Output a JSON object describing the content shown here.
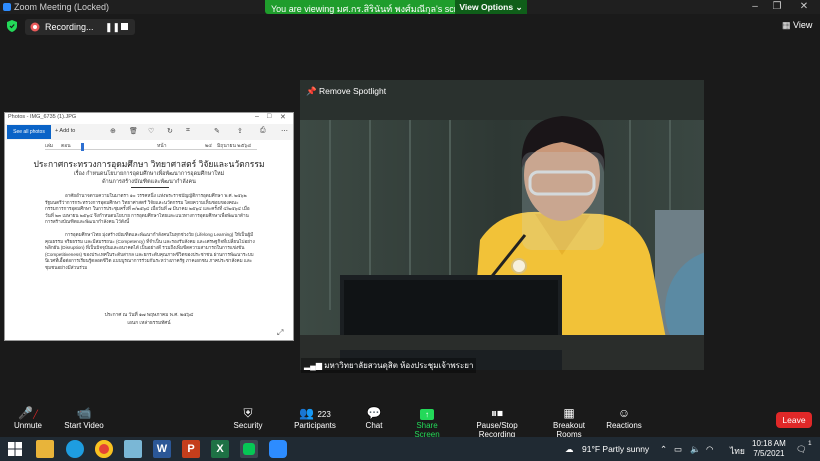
{
  "window": {
    "title": "Zoom Meeting (Locked)"
  },
  "banner": {
    "text": "You are viewing มศ.กร.สิรินันท์ พงศ์มณีกุล's screen",
    "options": "View Options ⌄"
  },
  "recording": {
    "label": "Recording..."
  },
  "topbar": {
    "view_label": "View"
  },
  "shared": {
    "window_title": "Photos - IMG_6735 (1).JPG",
    "see_all": "See all photos",
    "add_to": "+ Add to",
    "doc_title": "ประกาศกระทรวงการอุดมศึกษา วิทยาศาสตร์ วิจัยและนวัตกรรม",
    "doc_subject": "เรื่อง กำหนดนโยบายการอุดมศึกษาเพื่อพัฒนาการอุดมศึกษาใหม่",
    "doc_subject2": "ด้านการสร้างบัณฑิตและพัฒนากำลังคน",
    "para1": "อาศัยอำนาจตามความในมาตรา ๑๐ วรรคหนึ่ง แห่งพระราชบัญญัติการอุดมศึกษา พ.ศ. ๒๕๖๒ รัฐมนตรีว่าการกระทรวงการอุดมศึกษา วิทยาศาสตร์ วิจัยและนวัตกรรม โดยความเห็นชอบของคณะกรรมการการอุดมศึกษา ในการประชุมครั้งที่ ๓/๒๕๖๔ เมื่อวันที่ ๗ มีนาคม ๒๕๖๔ และครั้งที่ ๔/๒๕๖๔ เมื่อวันที่ ๒๓ เมษายน ๒๕๖๔ จึงกำหนดนโยบาย การอุดมศึกษาไทยและแนวทางการอุดมศึกษาเพื่อพัฒนาด้านการสร้างบัณฑิตและพัฒนากำลังคน ไว้ดังนี้",
    "para2": "การอุดมศึกษาไทย มุ่งสร้างบัณฑิตและพัฒนากำลังคนในทุกช่วงวัย (Lifelong Learning) ให้เป็นผู้มีคุณธรรม จริยธรรม และมีสมรรถนะ (Competency) ที่จำเป็น และรองรับสังคม และเศรษฐกิจที่เปลี่ยนไปอย่างพลิกผัน (Disruption) ที่เป็นปัจจุบันและอนาคตได้ เป็นอย่างดี รวมถึงเพิ่มขีดความสามารถในการแข่งขัน (Competitiveness) ของประเทศในระดับสากล และยกระดับคุณภาพชีวิตของประชาชน ผ่านการพัฒนาระบบนิเวศที่เอื้อต่อการเรียนรู้ตลอดชีวิต แบบบูรณาการร่วมกันระหว่างภาครัฐ ภาคเอกชน ภาคประชาสังคม และชุมชนอย่างมีส่วนร่วม",
    "sign_date": "ประกาศ ณ วันที่ ๑๗ พฤษภาคม พ.ศ. ๒๕๖๔",
    "sign_name": "เอนก เหล่าธรรมทัศน์",
    "header_fields": [
      "เล่ม",
      "ตอน",
      "หน้า",
      "๒๔",
      "มิถุนายน ๒๕๖๔"
    ]
  },
  "video": {
    "spotlight_label": "Remove Spotlight",
    "participant_name": "มหาวิทยาลัยสวนดุสิต ห้องประชุมเจ้าพระยา"
  },
  "toolbar": {
    "unmute": "Unmute",
    "start_video": "Start Video",
    "security": "Security",
    "participants": "Participants",
    "participants_count": "223",
    "chat": "Chat",
    "share_screen": "Share Screen",
    "pause_stop_recording": "Pause/Stop Recording",
    "breakout_rooms": "Breakout Rooms",
    "reactions": "Reactions",
    "leave": "Leave"
  },
  "taskbar": {
    "weather": "91°F  Partly sunny",
    "language": "ไทย",
    "time": "10:18 AM",
    "date": "7/5/2021",
    "notification_count": "1"
  },
  "colors": {
    "share_green": "#1f9d2c",
    "leave_red": "#e02828",
    "zoom_blue": "#2d8cff"
  }
}
